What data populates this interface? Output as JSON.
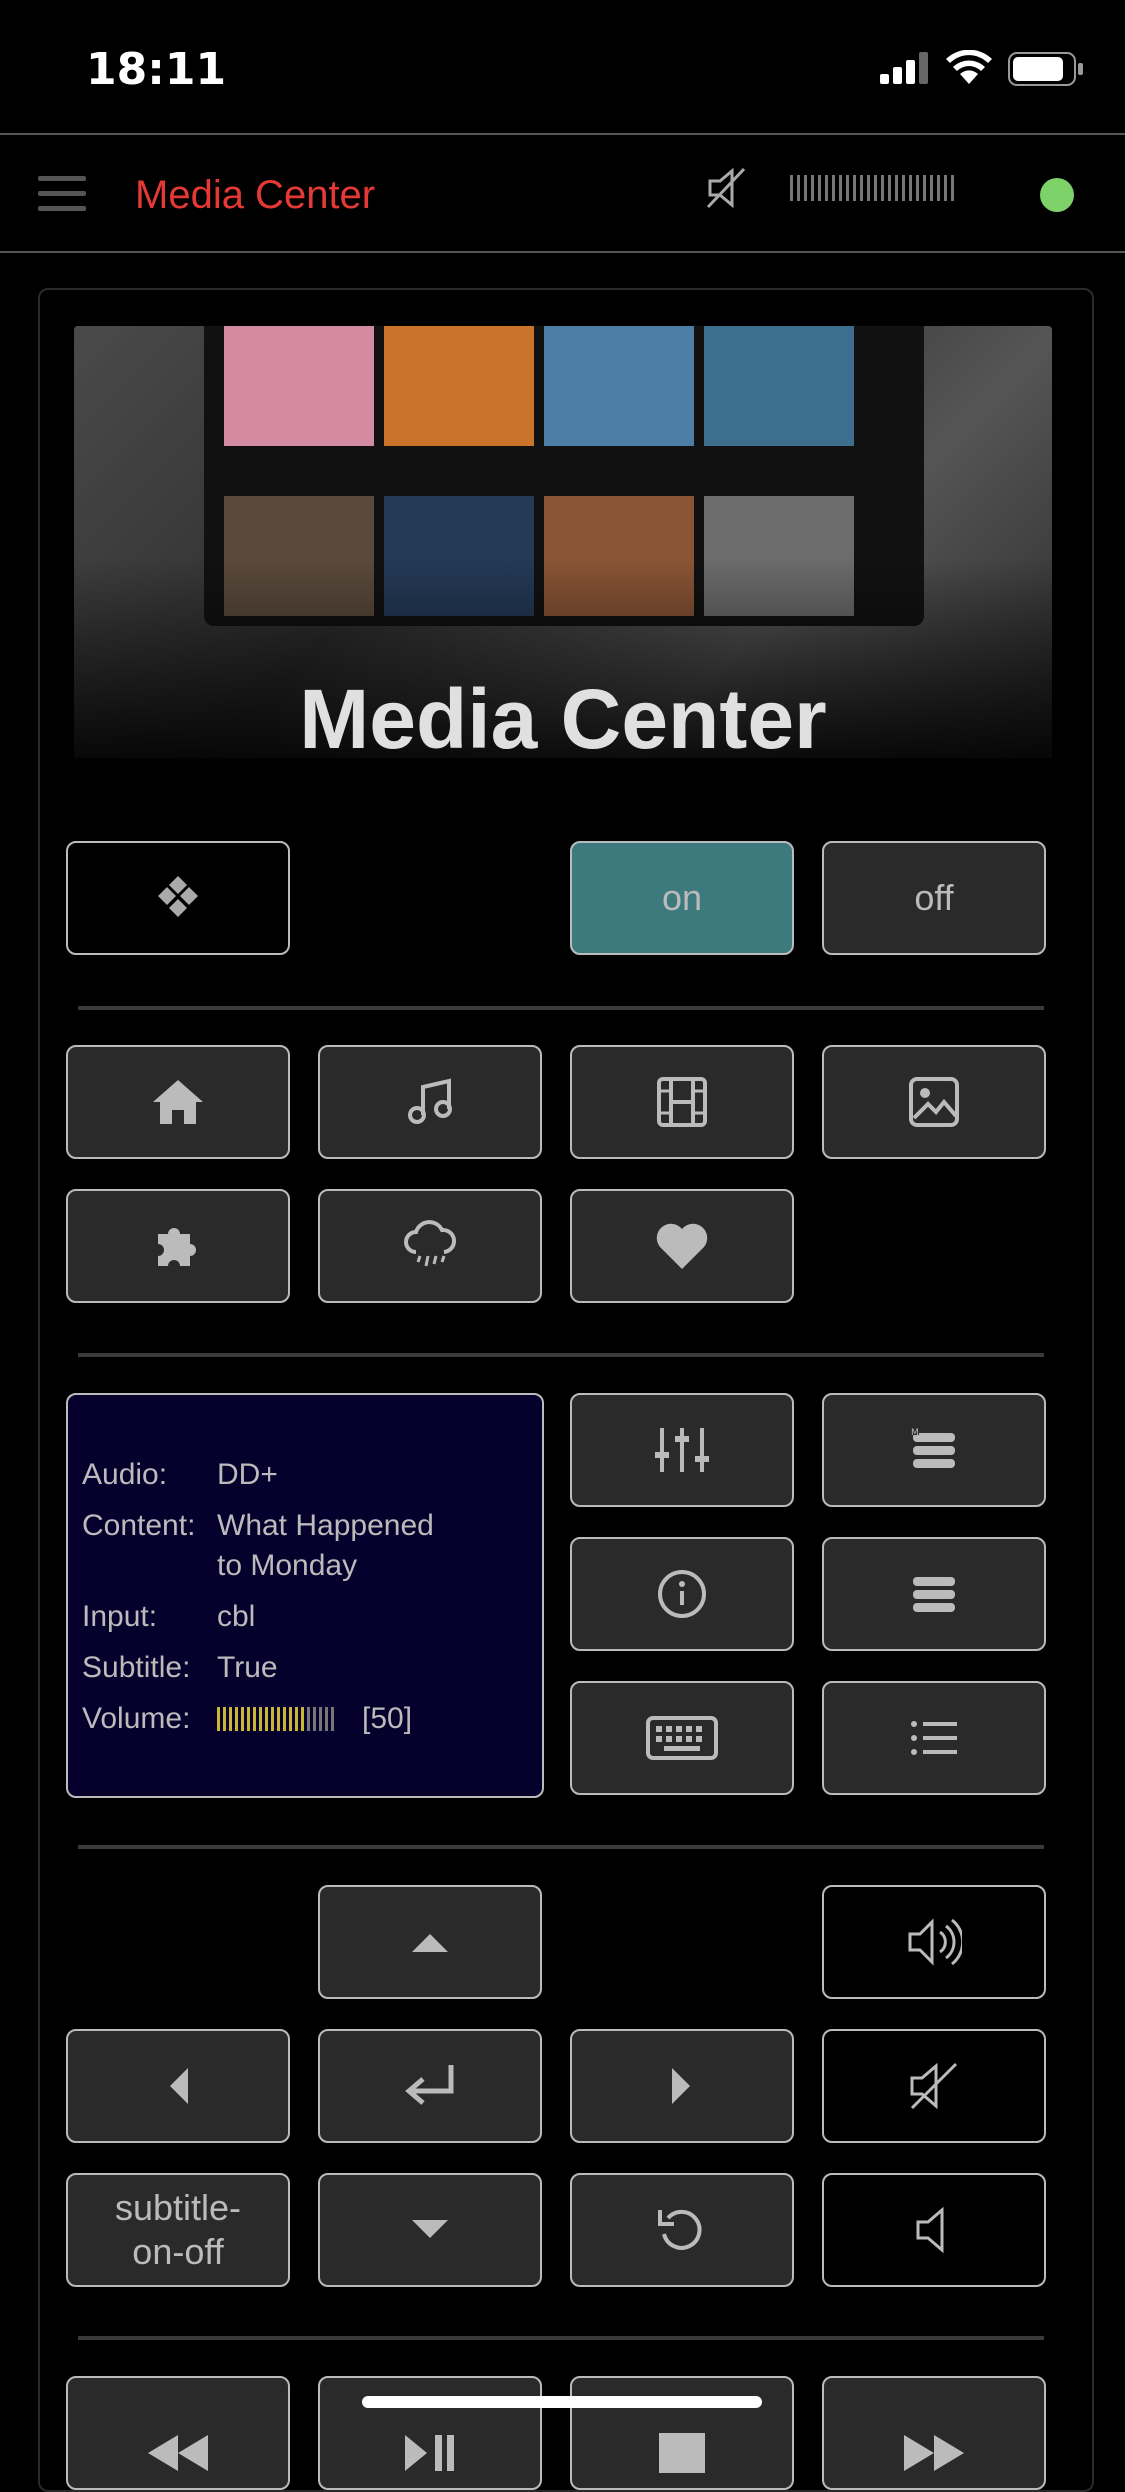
{
  "status_bar": {
    "time": "18:11"
  },
  "app_bar": {
    "title": "Media Center",
    "connection_color": "#7ed26a"
  },
  "hero": {
    "title": "Media Center"
  },
  "power": {
    "on_label": "on",
    "off_label": "off",
    "on_color": "#3d7a7e"
  },
  "now_playing": {
    "audio_label": "Audio:",
    "audio_value": "DD+",
    "content_label": "Content:",
    "content_value_line1": "What Happened",
    "content_value_line2": "to Monday",
    "input_label": "Input:",
    "input_value": "cbl",
    "subtitle_label": "Subtitle:",
    "subtitle_value": "True",
    "volume_label": "Volume:",
    "volume_value": "[50]",
    "volume_level": 0.5,
    "volume_active_color": "#c9b634"
  },
  "navigation": {
    "subtitle_button_line1": "subtitle-",
    "subtitle_button_line2": "on-off"
  }
}
